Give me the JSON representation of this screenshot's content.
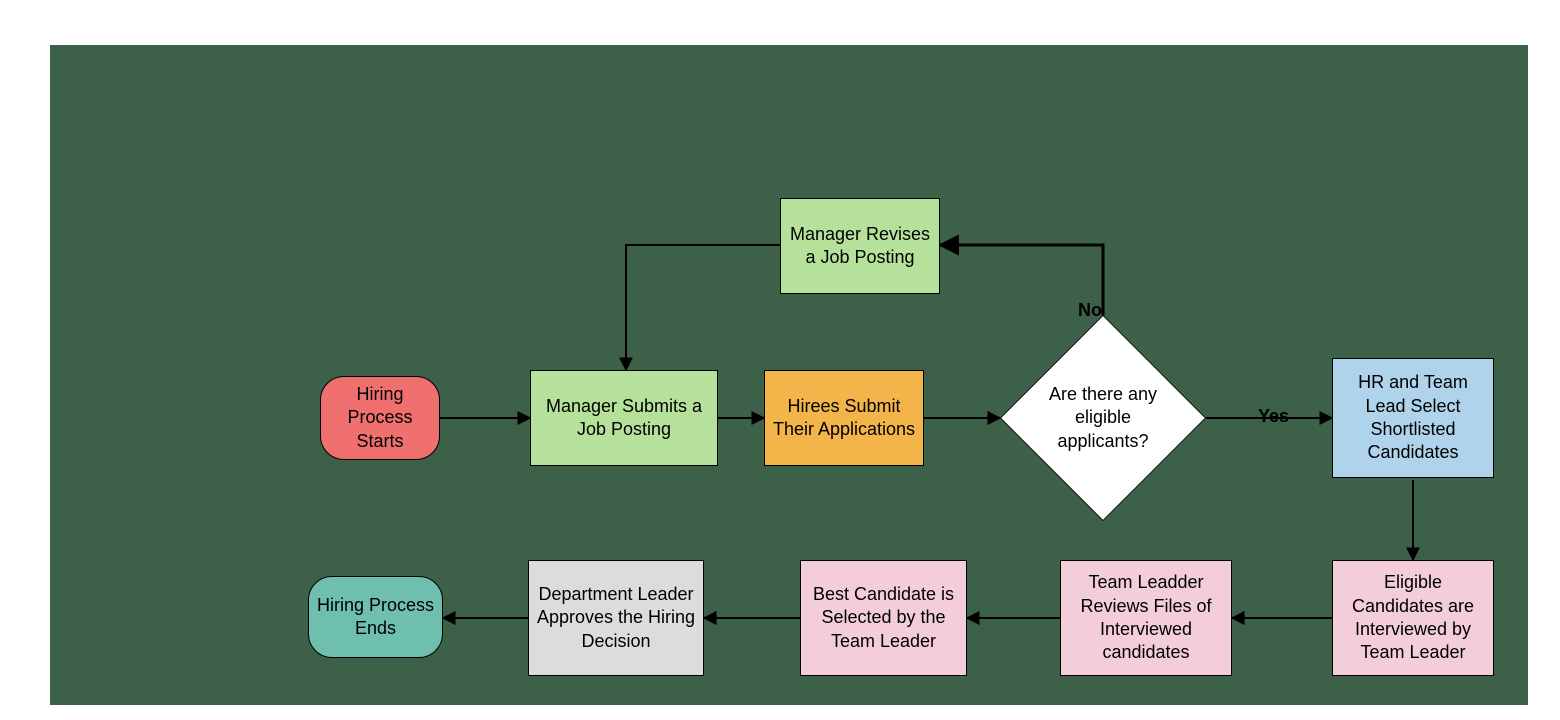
{
  "nodes": {
    "start": {
      "label": "Hiring Process Starts"
    },
    "submitJob": {
      "label": "Manager Submits a Job Posting"
    },
    "reviseJob": {
      "label": "Manager Revises a Job Posting"
    },
    "hireesSubmit": {
      "label": "Hirees Submit Their Applications"
    },
    "decision": {
      "label": "Are there any eligible applicants?"
    },
    "selectShort": {
      "label": "HR and Team Lead Select Shortlisted Candidates"
    },
    "interview": {
      "label": "Eligible Candidates are Interviewed by Team Leader"
    },
    "reviewFiles": {
      "label": "Team Leadder Reviews  Files of Interviewed candidates"
    },
    "bestCand": {
      "label": "Best Candidate is Selected by the Team Leader"
    },
    "deptApprove": {
      "label": "Department Leader Approves the Hiring Decision"
    },
    "end": {
      "label": "Hiring Process Ends"
    }
  },
  "edgeLabels": {
    "yes": "Yes",
    "no": "No"
  },
  "colors": {
    "background": "#3c6148",
    "start": "#f07070",
    "end": "#6fbfae",
    "green": "#b5e19a",
    "orange": "#f3b549",
    "blue": "#aed3ea",
    "pink": "#f3cdd9",
    "grey": "#dcdcdc",
    "white": "#ffffff"
  }
}
